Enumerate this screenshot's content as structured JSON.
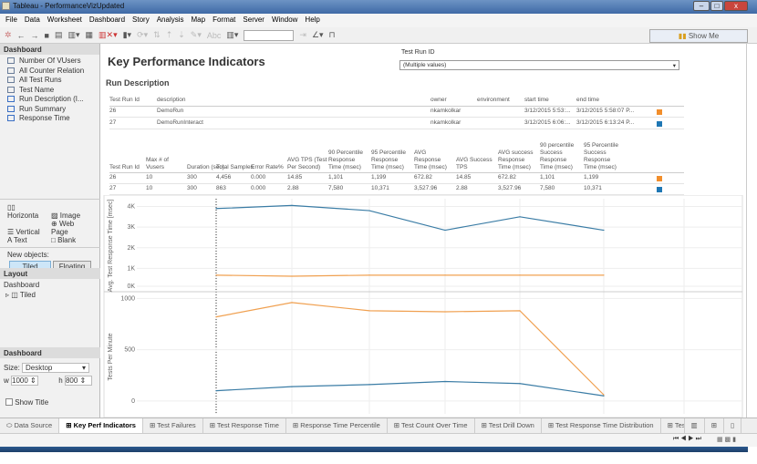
{
  "window": {
    "title": "Tableau - PerformanceVizUpdated"
  },
  "menu": [
    "File",
    "Data",
    "Worksheet",
    "Dashboard",
    "Story",
    "Analysis",
    "Map",
    "Format",
    "Server",
    "Window",
    "Help"
  ],
  "toolbar": {
    "show_me": "Show Me"
  },
  "left": {
    "dashboard_header": "Dashboard",
    "sheets": [
      "Number Of VUsers",
      "All Counter Relation",
      "All Test Runs",
      "Test Name",
      "Run Description (I...",
      "Run Summary",
      "Response Time"
    ],
    "objects": [
      "Horizonta",
      "Image",
      "Vertical",
      "Web Page",
      "Text",
      "Blank"
    ],
    "new_objects_label": "New objects:",
    "tiled": "Tiled",
    "floating": "Floating",
    "layout_header": "Layout",
    "layout_dashboard": "Dashboard",
    "layout_tiled": "Tiled",
    "size_header": "Dashboard",
    "size_label": "Size:",
    "size_value": "Desktop",
    "w_label": "w",
    "w_value": "1000",
    "h_label": "h",
    "h_value": "800",
    "show_title": "Show Title"
  },
  "dashboard": {
    "title": "Key Performance Indicators",
    "filter_label": "Test Run ID",
    "filter_value": "(Multiple values)",
    "run_desc_title": "Run Description",
    "desc_headers": [
      "Test Run Id",
      "description",
      "owner",
      "environment",
      "start time",
      "end time"
    ],
    "desc_rows": [
      [
        "26",
        "DemoRun",
        "nkamkolkar",
        "",
        "3/12/2015 5:53:...",
        "3/12/2015 5:58:07 P..."
      ],
      [
        "27",
        "DemoRunInteract",
        "nkamkolkar",
        "",
        "3/12/2015 6:06:...",
        "3/12/2015 6:13:24 P..."
      ]
    ],
    "summary_headers": [
      "Test Run Id",
      "Max # of Vusers",
      "Duration (sec)",
      "Total Samples",
      "Error Rate%",
      "AVG TPS (Test Per Second)",
      "90 Percentile Response Time (msec)",
      "95 Percentile Response Time (msec)",
      "AVG Response Time (msec)",
      "AVG Success TPS",
      "AVG success Response Time (msec)",
      "90 percentile Success Response Time (msec)",
      "95 Percentile Success Response Time (msec)"
    ],
    "summary_rows": [
      [
        "26",
        "10",
        "300",
        "4,456",
        "0.000",
        "14.85",
        "1,101",
        "1,199",
        "672.82",
        "14.85",
        "672.82",
        "1,101",
        "1,199"
      ],
      [
        "27",
        "10",
        "300",
        "863",
        "0.000",
        "2.88",
        "7,580",
        "10,371",
        "3,527.96",
        "2.88",
        "3,527.96",
        "7,580",
        "10,371"
      ]
    ],
    "run_colors": [
      "#f28e2b",
      "#1f77b4"
    ]
  },
  "chart_data": [
    {
      "type": "line",
      "ylabel": "Avg. Test Response Time [msec]",
      "yticks": [
        "0K",
        "1K",
        "2K",
        "3K",
        "4K"
      ],
      "ylim": [
        0,
        4200
      ],
      "grid": true,
      "series": [
        {
          "color": "#3a7ca5",
          "values": [
            3900,
            4050,
            3800,
            2850,
            3500,
            2850
          ]
        },
        {
          "color": "#f0a050",
          "values": [
            670,
            620,
            670,
            670,
            670,
            670
          ]
        }
      ]
    },
    {
      "type": "line",
      "ylabel": "Tests Per Minute",
      "yticks": [
        "0",
        "500",
        "1000"
      ],
      "ylim": [
        -170,
        1030
      ],
      "grid": true,
      "series": [
        {
          "color": "#f0a050",
          "values": [
            820,
            960,
            880,
            870,
            880,
            60
          ]
        },
        {
          "color": "#3a7ca5",
          "values": [
            100,
            140,
            160,
            190,
            170,
            50
          ]
        }
      ]
    }
  ],
  "tabs": [
    "Data Source",
    "Key Perf Indicators",
    "Test Failures",
    "Test Response Time",
    "Response Time Percentile",
    "Test Count Over Time",
    "Test Drill Down",
    "Test Response Time Distribution",
    "Tes"
  ]
}
